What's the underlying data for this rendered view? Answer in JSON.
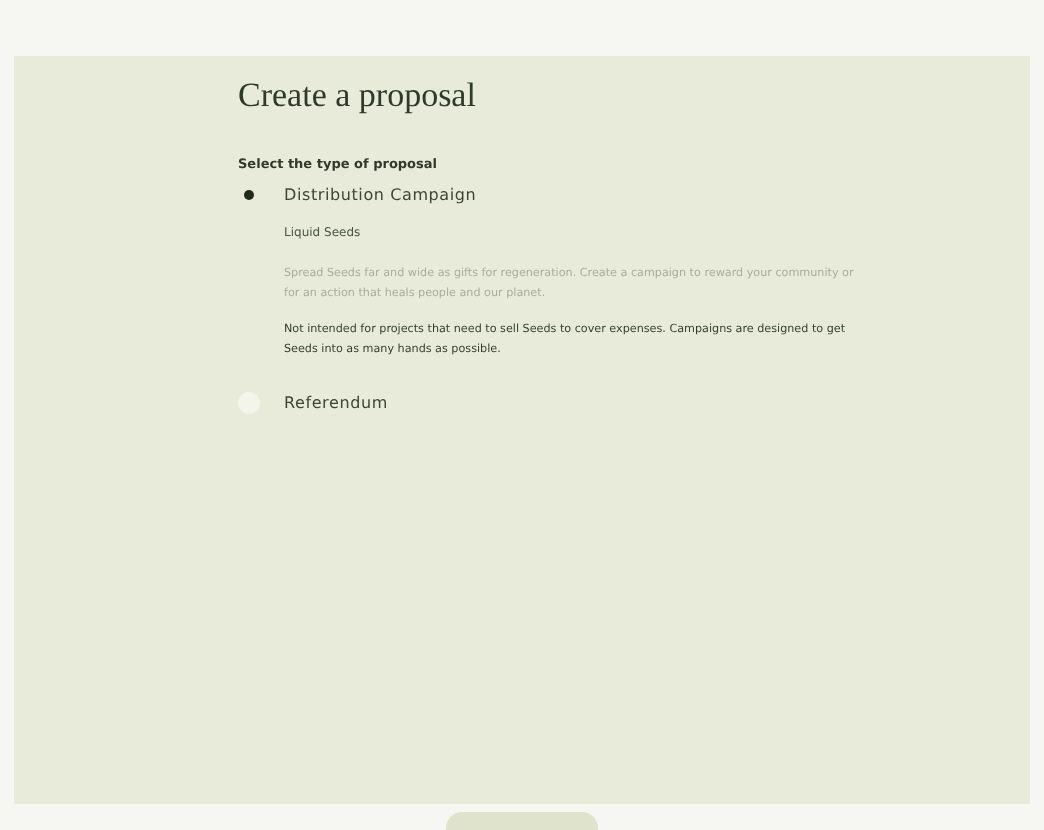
{
  "title": "Create a proposal",
  "section_label": "Select the type of proposal",
  "options": [
    {
      "label": "Distribution Campaign",
      "selected": true,
      "subtitle": "Liquid Seeds",
      "description": "Spread Seeds far and wide as gifts for regeneration. Create a campaign to reward your community or for an action that heals people and our planet.",
      "note": "Not intended for projects that need to sell Seeds to cover expenses. Campaigns are designed to get Seeds into as many hands as possible."
    },
    {
      "label": "Referendum",
      "selected": false
    }
  ]
}
